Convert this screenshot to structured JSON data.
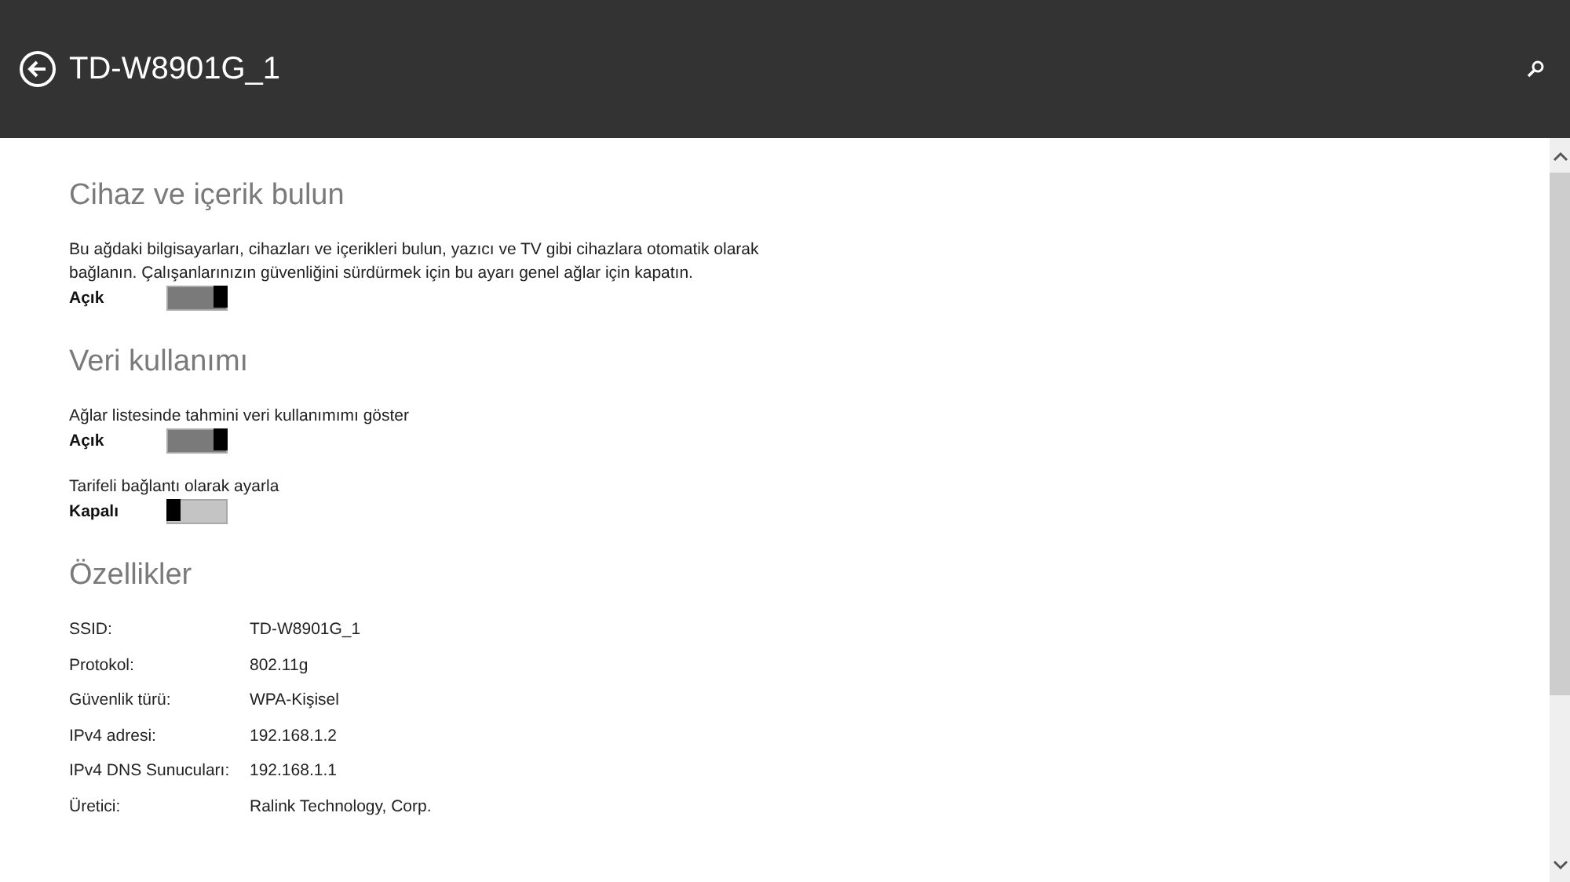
{
  "header": {
    "title": "TD-W8901G_1"
  },
  "sections": [
    {
      "kind": "toggles",
      "title": "Cihaz ve içerik bulun",
      "items": [
        {
          "description": "Bu ağdaki bilgisayarları, cihazları ve içerikleri bulun, yazıcı ve TV gibi cihazlara otomatik olarak bağlanın. Çalışanlarınızın güvenliğini sürdürmek için bu ayarı genel ağlar için kapatın.",
          "state_label": "Açık",
          "on": true
        }
      ]
    },
    {
      "kind": "toggles",
      "title": "Veri kullanımı",
      "items": [
        {
          "description": "Ağlar listesinde tahmini veri kullanımımı göster",
          "state_label": "Açık",
          "on": true
        },
        {
          "description": "Tarifeli bağlantı olarak ayarla",
          "state_label": "Kapalı",
          "on": false
        }
      ]
    },
    {
      "kind": "properties",
      "title": "Özellikler",
      "rows": [
        {
          "label": "SSID:",
          "value": "TD-W8901G_1"
        },
        {
          "label": "Protokol:",
          "value": "802.11g"
        },
        {
          "label": "Güvenlik türü:",
          "value": "WPA-Kişisel"
        },
        {
          "label": "IPv4 adresi:",
          "value": "192.168.1.2"
        },
        {
          "label": "IPv4 DNS Sunucuları:",
          "value": "192.168.1.1"
        },
        {
          "label": "Üretici:",
          "value": "Ralink Technology, Corp."
        }
      ]
    }
  ]
}
